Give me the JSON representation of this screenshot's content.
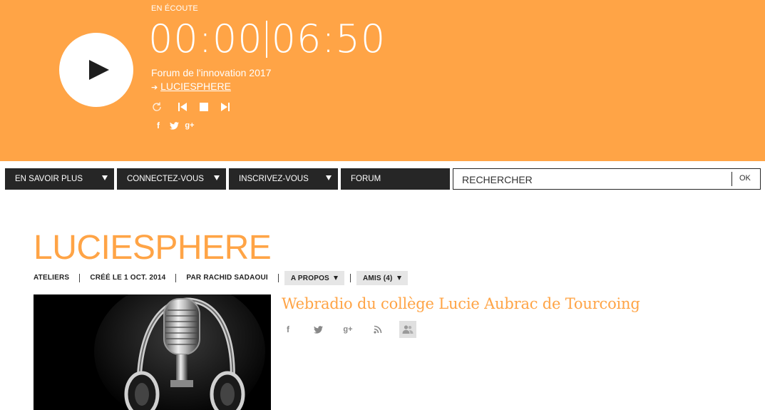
{
  "colors": {
    "accent": "#ffa446",
    "dark": "#262626",
    "white": "#ffffff"
  },
  "player": {
    "status_label": "EN ÉCOUTE",
    "elapsed": "00:00",
    "duration": "06:50",
    "track_title": "Forum de l'innovation 2017",
    "arrow": "➔",
    "channel_link": "LUCIESPHERE",
    "icons": [
      "play-icon",
      "repeat-icon",
      "previous-icon",
      "stop-icon",
      "next-icon",
      "facebook-icon",
      "twitter-icon",
      "google-plus-icon"
    ]
  },
  "social": {
    "facebook": "f",
    "google_plus": "g+"
  },
  "nav": {
    "items": [
      {
        "label": "EN SAVOIR PLUS",
        "has_dropdown": true
      },
      {
        "label": "CONNECTEZ-VOUS",
        "has_dropdown": true
      },
      {
        "label": "INSCRIVEZ-VOUS",
        "has_dropdown": true
      },
      {
        "label": "FORUM",
        "has_dropdown": false
      }
    ],
    "search": {
      "placeholder": "RECHERCHER",
      "submit_label": "OK"
    }
  },
  "page": {
    "title": "LUCIESPHERE",
    "meta": [
      "ATELIERS",
      "CRÉÉ LE 1 OCT. 2014",
      "PAR RACHID SADAOUI"
    ],
    "about_label": "A PROPOS",
    "friends_label": "AMIS (4)",
    "subtitle": "Webradio du collège Lucie Aubrac de Tourcoing",
    "cover_image": "microphone-headphones-image"
  }
}
